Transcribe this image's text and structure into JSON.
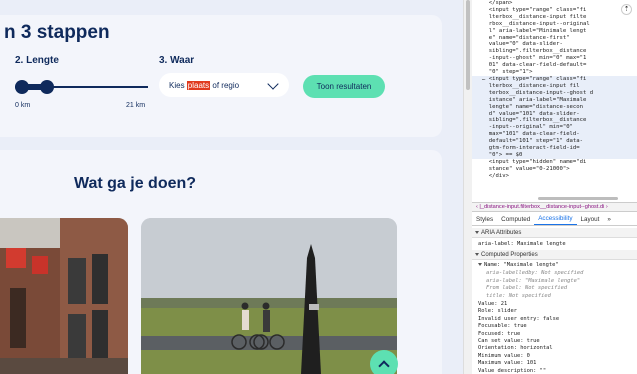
{
  "filter": {
    "title": "n 3 stappen",
    "length_label": "2. Lengte",
    "where_label": "3. Waar",
    "km_min": "0 km",
    "km_max": "21 km",
    "slider_value_fraction": 0.21,
    "select_before": "Kies ",
    "select_highlight": "plaats",
    "select_after": " of regio",
    "results_button": "Toon resultaten"
  },
  "content": {
    "title": "Wat ga je doen?"
  },
  "devtools": {
    "code_lines": [
      {
        "cls": "",
        "text": "  </span>"
      },
      {
        "cls": "",
        "text": "  <input type=\"range\" class=\"fi"
      },
      {
        "cls": "",
        "text": "  lterbox__distance-input filte"
      },
      {
        "cls": "",
        "text": "  rbox__distance-input--original"
      },
      {
        "cls": "",
        "text": "  l\" aria-label=\"Minimale lengt"
      },
      {
        "cls": "",
        "text": "  e\" name=\"distance-first\""
      },
      {
        "cls": "",
        "text": "  value=\"0\" data-slider-"
      },
      {
        "cls": "",
        "text": "  sibling=\".filterbox__distance"
      },
      {
        "cls": "",
        "text": "  -input--ghost\" min=\"0\" max=\"1"
      },
      {
        "cls": "",
        "text": "  01\" data-clear-field-default="
      },
      {
        "cls": "",
        "text": "  \"0\" step=\"1\">"
      },
      {
        "cls": "sel",
        "text": "… <input type=\"range\" class=\"fi"
      },
      {
        "cls": "sel",
        "text": "  lterbox__distance-input fil"
      },
      {
        "cls": "sel",
        "text": "  terbox__distance-input--ghost d"
      },
      {
        "cls": "sel",
        "text": "  istance\" aria-label=\"Maximale"
      },
      {
        "cls": "sel",
        "text": "  lengte\" name=\"distance-secon"
      },
      {
        "cls": "sel",
        "text": "  d\" value=\"101\" data-slider-"
      },
      {
        "cls": "sel",
        "text": "  sibling=\".filterbox__distance"
      },
      {
        "cls": "sel",
        "text": "  -input--original\" min=\"0\""
      },
      {
        "cls": "sel",
        "text": "  max=\"101\" data-clear-field-"
      },
      {
        "cls": "sel",
        "text": "  default=\"101\" step=\"1\" data-"
      },
      {
        "cls": "sel",
        "text": "  gtm-form-interact-field-id="
      },
      {
        "cls": "sel",
        "text": "  \"0\"> == $0"
      },
      {
        "cls": "",
        "text": "  <input type=\"hidden\" name=\"di"
      },
      {
        "cls": "",
        "text": "  stance\" value=\"0-21000\">"
      },
      {
        "cls": "",
        "text": "  </div>"
      }
    ],
    "breadcrumb": "‹ |_distance-input.filterbox__distance-input--ghost.di ›",
    "tabs": [
      "Styles",
      "Computed",
      "Accessibility",
      "Layout",
      "»"
    ],
    "active_tab": "Accessibility",
    "aria_header": "ARIA Attributes",
    "aria_label_line": "aria-label: Maximale lengte",
    "computed_header": "Computed Properties",
    "name_line": "Name: \"Maximale lengte\"",
    "sub_lines": [
      "aria-labelledby: Not specified",
      "aria-label: \"Maximale lengte\"",
      "From label: Not specified",
      "title: Not specified"
    ],
    "props": [
      "Value: 21",
      "Role: slider",
      "Invalid user entry: false",
      "Focusable: true",
      "Focused: true",
      "Can set value: true",
      "Orientation: horizontal",
      "Minimum value: 0",
      "Maximum value: 101",
      "Value description: \"\""
    ]
  }
}
